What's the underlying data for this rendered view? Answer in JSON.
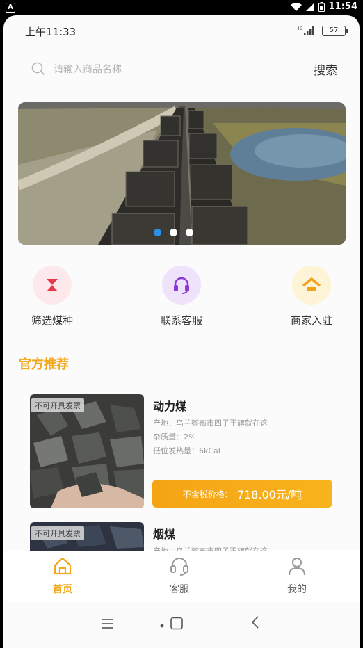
{
  "system_status": {
    "time": "11:54",
    "left_icon": "A"
  },
  "app_status": {
    "time": "上午11:33",
    "network": "4G",
    "battery": "57"
  },
  "search": {
    "placeholder": "请输入商品名称",
    "button_label": "搜索"
  },
  "banner": {
    "slide_count": 3,
    "active_index": 0
  },
  "quick_entries": [
    {
      "label": "筛选煤种",
      "icon": "hourglass-icon",
      "color": "#e8394a",
      "bg": "#fde9ec"
    },
    {
      "label": "联系客服",
      "icon": "headset-icon",
      "color": "#8a3ad6",
      "bg": "#efe2fb"
    },
    {
      "label": "商家入驻",
      "icon": "home-roof-icon",
      "color": "#f2a31b",
      "bg": "#fdf3d6"
    }
  ],
  "section_title": "官方推荐",
  "products": [
    {
      "tag": "不可开具发票",
      "name": "动力煤",
      "origin": "产地：乌兰察布市四子王旗就在这",
      "impurity": "杂质量：2%",
      "heat": "低位发热量：6kCal",
      "price_label": "不含税价格：",
      "price_value": "718.00元/吨"
    },
    {
      "tag": "不可开具发票",
      "name": "烟煤",
      "origin": "产地：乌兰察布市四子王旗就在这"
    }
  ],
  "tabs": [
    {
      "label": "首页",
      "icon": "home-icon",
      "active": true
    },
    {
      "label": "客服",
      "icon": "headset-icon",
      "active": false
    },
    {
      "label": "我的",
      "icon": "user-icon",
      "active": false
    }
  ],
  "colors": {
    "accent": "#f2a81a",
    "active_dot": "#2b8fe8"
  }
}
